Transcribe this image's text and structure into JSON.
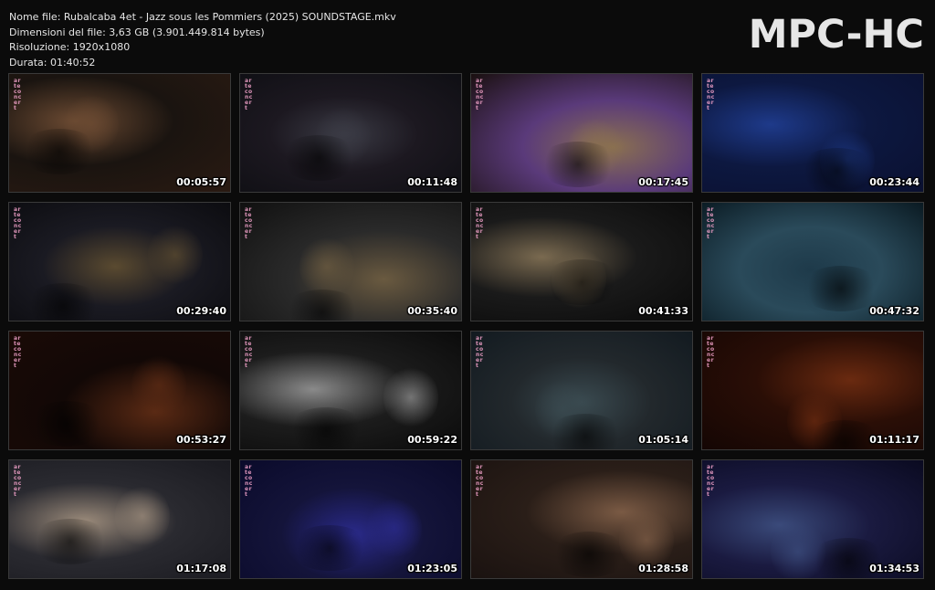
{
  "header": {
    "filename": "Nome file: Rubalcaba 4et - Jazz sous les Pommiers (2025) SOUNDSTAGE.mkv",
    "filesize": "Dimensioni del file: 3,63 GB (3.901.449.814 bytes)",
    "resolution": "Risoluzione: 1920x1080",
    "duration": "Durata: 01:40:52"
  },
  "logo": "MPC-HC",
  "thumbnails": [
    {
      "timestamp": "00:05:57",
      "palette": [
        "#2a1a12",
        "#6b4a32",
        "#1a1410"
      ]
    },
    {
      "timestamp": "00:11:48",
      "palette": [
        "#0f0f14",
        "#3a3a44",
        "#1c1820"
      ]
    },
    {
      "timestamp": "00:17:45",
      "palette": [
        "#1a1010",
        "#8a7050",
        "#5a3a7a"
      ]
    },
    {
      "timestamp": "00:23:44",
      "palette": [
        "#0a1030",
        "#1e3a8a",
        "#0d1840"
      ]
    },
    {
      "timestamp": "00:29:40",
      "palette": [
        "#0c0c10",
        "#5a4a30",
        "#1a1a22"
      ]
    },
    {
      "timestamp": "00:35:40",
      "palette": [
        "#101010",
        "#6a5a40",
        "#2a2a2a"
      ]
    },
    {
      "timestamp": "00:41:33",
      "palette": [
        "#0a0a0a",
        "#7a6a50",
        "#1a1a1a"
      ]
    },
    {
      "timestamp": "00:47:32",
      "palette": [
        "#0a1a22",
        "#1e3a4a",
        "#2a4a5a"
      ]
    },
    {
      "timestamp": "00:53:27",
      "palette": [
        "#1a0a06",
        "#5a2a14",
        "#120806"
      ]
    },
    {
      "timestamp": "00:59:22",
      "palette": [
        "#0a0a0a",
        "#8a8a8a",
        "#1c1c1c"
      ]
    },
    {
      "timestamp": "01:05:14",
      "palette": [
        "#121a20",
        "#3a4a50",
        "#22282c"
      ]
    },
    {
      "timestamp": "01:11:17",
      "palette": [
        "#140604",
        "#6a2a10",
        "#2a0e06"
      ]
    },
    {
      "timestamp": "01:17:08",
      "palette": [
        "#1a1a20",
        "#9a8a7a",
        "#2a2a30"
      ]
    },
    {
      "timestamp": "01:23:05",
      "palette": [
        "#0a0a2a",
        "#2a2a8a",
        "#14143a"
      ]
    },
    {
      "timestamp": "01:28:58",
      "palette": [
        "#1a1210",
        "#7a5a44",
        "#2a1e18"
      ]
    },
    {
      "timestamp": "01:34:53",
      "palette": [
        "#0a0a20",
        "#3a4a7a",
        "#1a1a40"
      ]
    }
  ],
  "watermark": "arte concert"
}
